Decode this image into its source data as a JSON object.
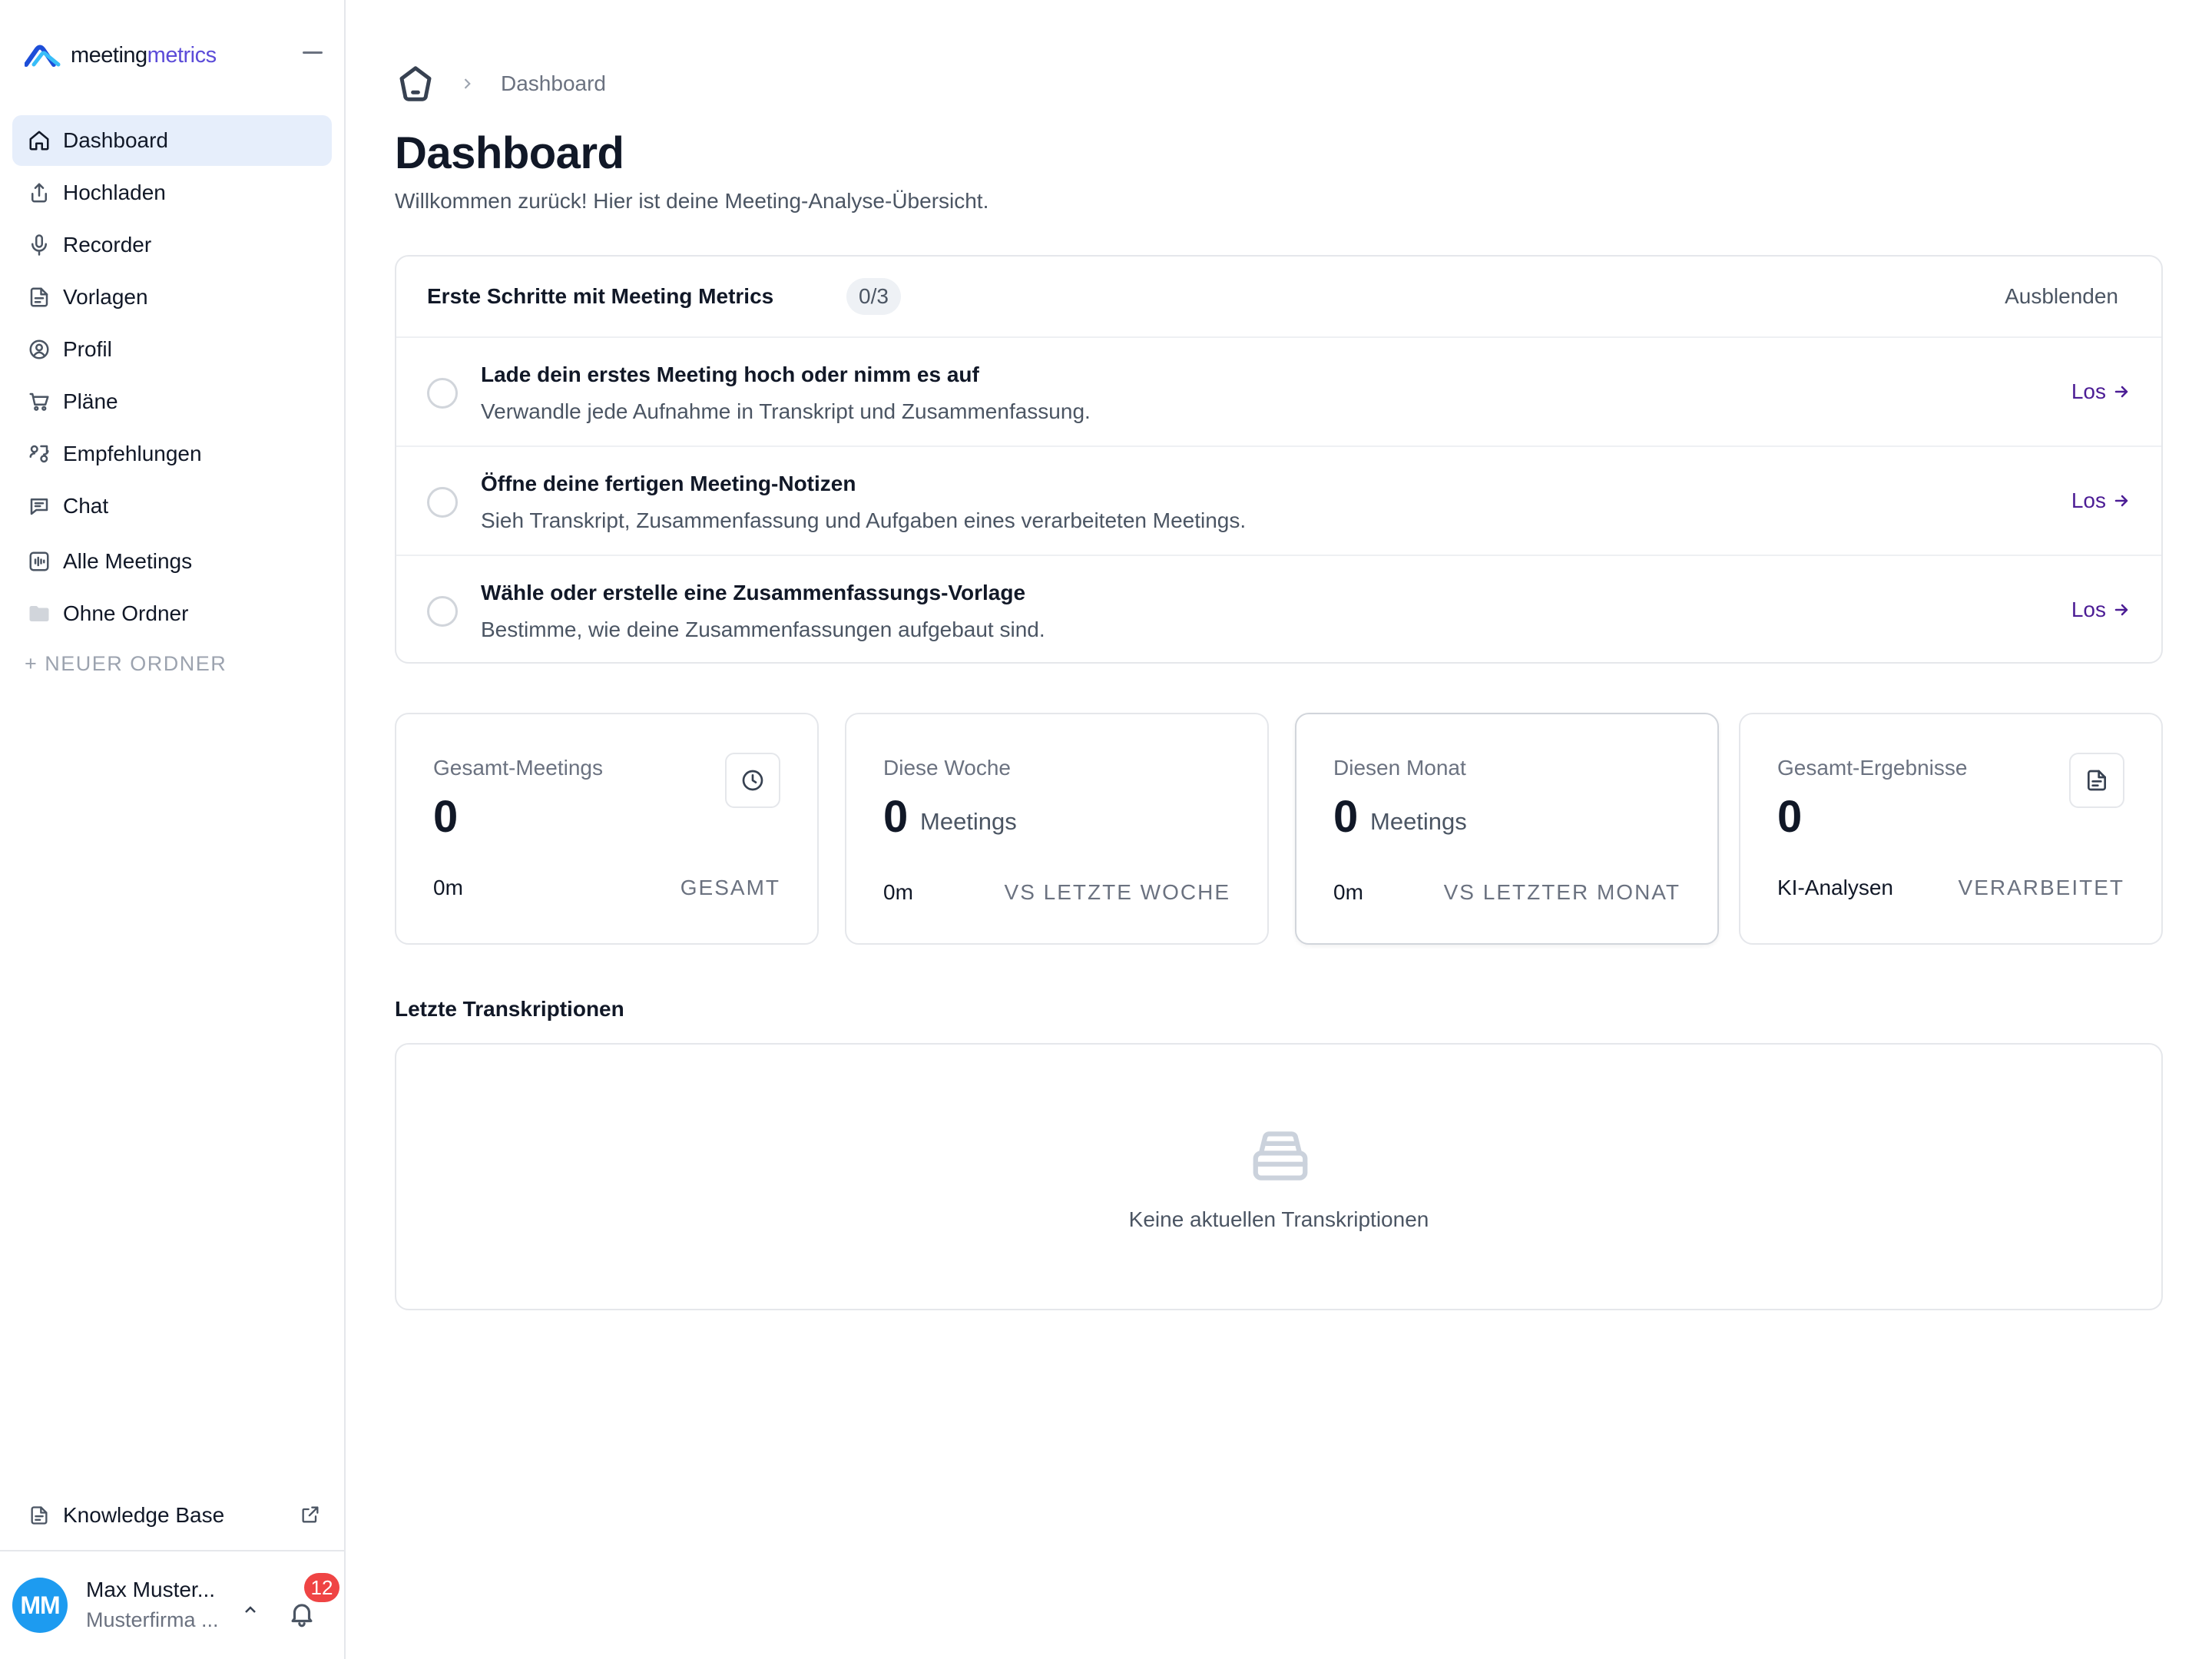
{
  "brand": {
    "name_part1": "meeting",
    "name_part2": "metrics",
    "accent_color": "#5b4bd8"
  },
  "sidebar": {
    "items": [
      {
        "label": "Dashboard",
        "icon": "home-icon",
        "active": true
      },
      {
        "label": "Hochladen",
        "icon": "upload-icon"
      },
      {
        "label": "Recorder",
        "icon": "microphone-icon"
      },
      {
        "label": "Vorlagen",
        "icon": "template-icon"
      },
      {
        "label": "Profil",
        "icon": "profile-icon"
      },
      {
        "label": "Pläne",
        "icon": "cart-icon"
      },
      {
        "label": "Empfehlungen",
        "icon": "referral-icon"
      },
      {
        "label": "Chat",
        "icon": "chat-icon"
      }
    ],
    "folders": [
      {
        "label": "Alle Meetings",
        "icon": "audio-wave-icon"
      },
      {
        "label": "Ohne Ordner",
        "icon": "folder-icon"
      }
    ],
    "new_folder_label": "+ NEUER ORDNER",
    "knowledge_base_label": "Knowledge Base"
  },
  "user": {
    "initials": "MM",
    "name": "Max Muster...",
    "org": "Musterfirma ...",
    "notification_count": "12",
    "avatar_color": "#1d9bf0"
  },
  "breadcrumb": {
    "current": "Dashboard"
  },
  "page": {
    "title": "Dashboard",
    "subtitle": "Willkommen zurück! Hier ist deine Meeting-Analyse-Übersicht."
  },
  "getting_started": {
    "title": "Erste Schritte mit Meeting Metrics",
    "progress": "0/3",
    "hide_label": "Ausblenden",
    "go_label": "Los",
    "steps": [
      {
        "title": "Lade dein erstes Meeting hoch oder nimm es auf",
        "description": "Verwandle jede Aufnahme in Transkript und Zusammenfassung."
      },
      {
        "title": "Öffne deine fertigen Meeting-Notizen",
        "description": "Sieh Transkript, Zusammenfassung und Aufgaben eines verarbeiteten Meetings."
      },
      {
        "title": "Wähle oder erstelle eine Zusammenfassungs-Vorlage",
        "description": "Bestimme, wie deine Zusammenfassungen aufgebaut sind."
      }
    ]
  },
  "stats": [
    {
      "label": "Gesamt-Meetings",
      "value": "0",
      "unit": "",
      "left": "0m",
      "right": "GESAMT",
      "icon": "clock-icon"
    },
    {
      "label": "Diese Woche",
      "value": "0",
      "unit": "Meetings",
      "left": "0m",
      "right": "VS LETZTE WOCHE"
    },
    {
      "label": "Diesen Monat",
      "value": "0",
      "unit": "Meetings",
      "left": "0m",
      "right": "VS LETZTER MONAT"
    },
    {
      "label": "Gesamt-Ergebnisse",
      "value": "0",
      "unit": "",
      "left": "KI-Analysen",
      "right": "VERARBEITET",
      "icon": "document-icon"
    }
  ],
  "recent": {
    "title": "Letzte Transkriptionen",
    "empty_text": "Keine aktuellen Transkriptionen",
    "empty_icon": "inbox-icon"
  }
}
